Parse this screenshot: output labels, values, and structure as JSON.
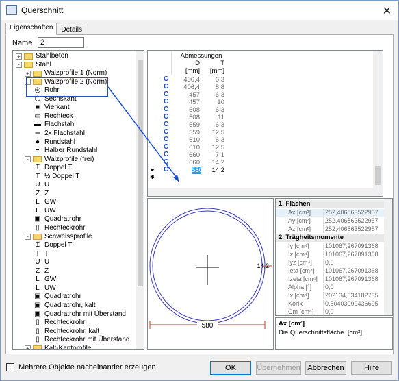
{
  "window": {
    "title": "Querschnitt"
  },
  "tabs": [
    {
      "label": "Eigenschaften"
    },
    {
      "label": "Details"
    }
  ],
  "name_field": {
    "label": "Name",
    "value": "2"
  },
  "tree": {
    "items": [
      {
        "label": "Stahlbeton",
        "expander": "+",
        "icon": "folder-icon"
      },
      {
        "label": "Stahl",
        "expander": "-",
        "icon": "folder-icon"
      },
      {
        "label": "Walzprofile 1 (Norm)",
        "expander": "+",
        "icon": "folder-icon"
      },
      {
        "label": "Walzprofile 2 (Norm)",
        "expander": "-",
        "icon": "folder-open-icon"
      },
      {
        "label": "Rohr",
        "icon": "tube-icon"
      },
      {
        "label": "Sechskant",
        "icon": "hexagon-icon"
      },
      {
        "label": "Vierkant",
        "icon": "square-bar-icon"
      },
      {
        "label": "Rechteck",
        "icon": "rectangle-icon"
      },
      {
        "label": "Flachstahl",
        "icon": "flat-bar-icon"
      },
      {
        "label": "2x Flachstahl",
        "icon": "double-flat-bar-icon"
      },
      {
        "label": "Rundstahl",
        "icon": "round-bar-icon"
      },
      {
        "label": "Halber Rundstahl",
        "icon": "half-round-icon"
      },
      {
        "label": "Walzprofile (frei)",
        "expander": "-",
        "icon": "folder-open-icon"
      },
      {
        "label": "Doppel T",
        "icon": "i-beam-icon"
      },
      {
        "label": "½ Doppel T",
        "icon": "t-beam-icon"
      },
      {
        "label": "U",
        "icon": "u-channel-icon"
      },
      {
        "label": "Z",
        "icon": "z-profile-icon"
      },
      {
        "label": "GW",
        "icon": "angle-icon"
      },
      {
        "label": "UW",
        "icon": "angle-unequal-icon"
      },
      {
        "label": "Quadratrohr",
        "icon": "square-tube-icon"
      },
      {
        "label": "Rechteckrohr",
        "icon": "rect-tube-icon"
      },
      {
        "label": "Schweissprofile",
        "expander": "-",
        "icon": "folder-open-icon"
      },
      {
        "label": "Doppel T",
        "icon": "i-beam-icon"
      },
      {
        "label": "T",
        "icon": "t-beam-icon"
      },
      {
        "label": "U",
        "icon": "u-channel-icon"
      },
      {
        "label": "Z",
        "icon": "z-profile-icon"
      },
      {
        "label": "GW",
        "icon": "angle-icon"
      },
      {
        "label": "UW",
        "icon": "angle-unequal-icon"
      },
      {
        "label": "Quadratrohr",
        "icon": "square-tube-icon"
      },
      {
        "label": "Quadratrohr, kalt",
        "icon": "square-tube-icon"
      },
      {
        "label": "Quadratrohr mit Überstand",
        "icon": "square-tube-flange-icon"
      },
      {
        "label": "Rechteckrohr",
        "icon": "rect-tube-icon"
      },
      {
        "label": "Rechteckrohr, kalt",
        "icon": "rect-tube-icon"
      },
      {
        "label": "Rechteckrohr mit Überstand",
        "icon": "rect-tube-flange-icon"
      },
      {
        "label": "Kalt-Kantorofile",
        "expander": "+",
        "icon": "folder-icon"
      }
    ]
  },
  "grid": {
    "group_header": "Abmessungen",
    "columns": [
      {
        "label": "D",
        "unit": "[mm]"
      },
      {
        "label": "T",
        "unit": "[mm]"
      }
    ],
    "rows": [
      {
        "D": "406,4",
        "T": "6,3"
      },
      {
        "D": "406,4",
        "T": "8,8"
      },
      {
        "D": "457",
        "T": "6,3"
      },
      {
        "D": "457",
        "T": "10"
      },
      {
        "D": "508",
        "T": "6,3"
      },
      {
        "D": "508",
        "T": "11"
      },
      {
        "D": "559",
        "T": "6,3"
      },
      {
        "D": "559",
        "T": "12,5"
      },
      {
        "D": "610",
        "T": "6,3"
      },
      {
        "D": "610",
        "T": "12,5"
      },
      {
        "D": "660",
        "T": "7,1"
      },
      {
        "D": "660",
        "T": "14,2"
      }
    ],
    "edit_row": {
      "D": "580",
      "T": "14,2",
      "marker": "►"
    },
    "new_row_marker": "✱"
  },
  "drawing": {
    "diameter_label": "580",
    "thickness_label": "14,2"
  },
  "properties": {
    "sections": [
      {
        "title": "1. Flächen",
        "rows": [
          {
            "name": "Ax [cm²]",
            "value": "252,406863522957"
          },
          {
            "name": "Ay [cm²]",
            "value": "252,406863522957"
          },
          {
            "name": "Az [cm²]",
            "value": "252,406863522957"
          }
        ]
      },
      {
        "title": "2. Trägheitsmomente",
        "rows": [
          {
            "name": "Iy [cm⁴]",
            "value": "101067,267091368"
          },
          {
            "name": "Iz [cm⁴]",
            "value": "101067,267091368"
          },
          {
            "name": "Iyz [cm⁴]",
            "value": "0,0"
          },
          {
            "name": "Ieta [cm⁴]",
            "value": "101067,267091368"
          },
          {
            "name": "Izeta [cm⁴]",
            "value": "101067,267091368"
          },
          {
            "name": "Alpha [°]",
            "value": "0,0"
          },
          {
            "name": "Ix [cm⁴]",
            "value": "202134,534182735"
          },
          {
            "name": "KorIx",
            "value": "0,50403099436695"
          },
          {
            "name": "Cm [cm⁶]",
            "value": "0,0"
          }
        ]
      }
    ]
  },
  "description": {
    "title": "Ax [cm²]",
    "text": "Die Querschnittsfläche. [cm²]"
  },
  "footer": {
    "checkbox_label": "Mehrere Objekte nacheinander erzeugen",
    "ok": "OK",
    "apply": "Übernehmen",
    "cancel": "Abbrechen",
    "help": "Hilfe"
  },
  "colors": {
    "accent": "#1b4fd1",
    "circle": "#3a3ab8",
    "dim": "#c0392b"
  }
}
